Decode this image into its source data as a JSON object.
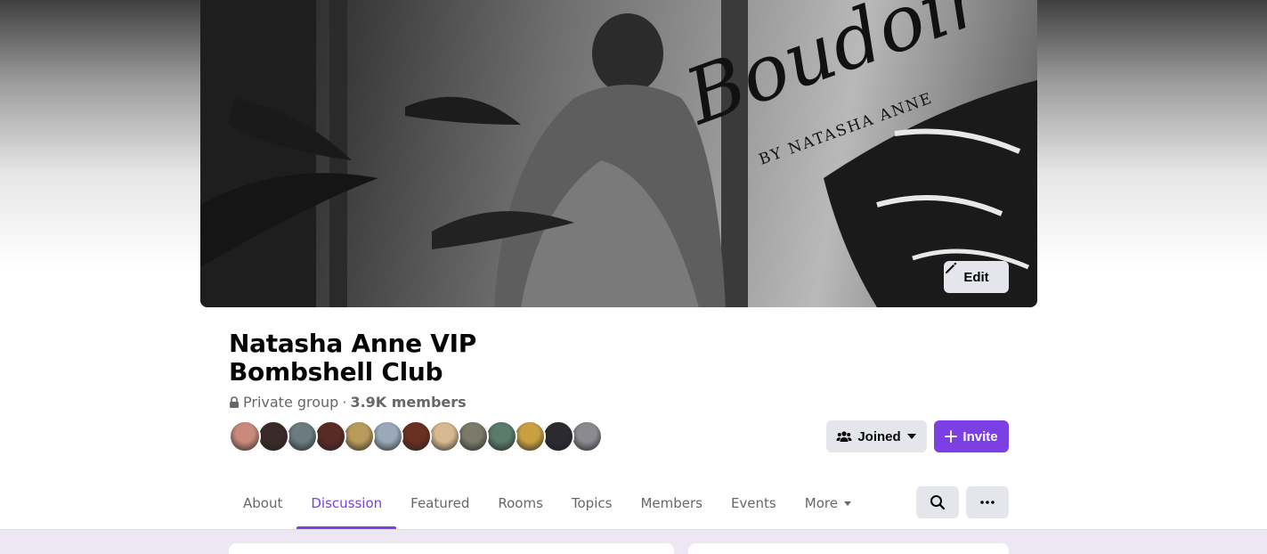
{
  "cover": {
    "title_script": "Boudoir",
    "byline": "BY NATASHA ANNE",
    "edit_label": "Edit"
  },
  "group": {
    "name": "Natasha Anne VIP Bombshell Club",
    "privacy": "Private group",
    "separator": "·",
    "members": "3.9K members"
  },
  "avatars": [
    {
      "color": "#c98a7a"
    },
    {
      "color": "#3a2a28"
    },
    {
      "color": "#6b7b80"
    },
    {
      "color": "#5a2a25"
    },
    {
      "color": "#b89a5a"
    },
    {
      "color": "#9aa8b8"
    },
    {
      "color": "#6a3020"
    },
    {
      "color": "#d8b890"
    },
    {
      "color": "#7a7a6a"
    },
    {
      "color": "#5a7a6a"
    },
    {
      "color": "#c8a040"
    },
    {
      "color": "#2a2a30"
    },
    {
      "color": "#8a8a90"
    }
  ],
  "actions": {
    "joined_label": "Joined",
    "invite_label": "Invite"
  },
  "tabs": [
    {
      "label": "About"
    },
    {
      "label": "Discussion",
      "active": true
    },
    {
      "label": "Featured"
    },
    {
      "label": "Rooms"
    },
    {
      "label": "Topics"
    },
    {
      "label": "Members"
    },
    {
      "label": "Events"
    },
    {
      "label": "More"
    }
  ],
  "colors": {
    "accent": "#7b3fe4",
    "button_gray": "#e4e6eb",
    "content_bg": "#ece7f2"
  }
}
